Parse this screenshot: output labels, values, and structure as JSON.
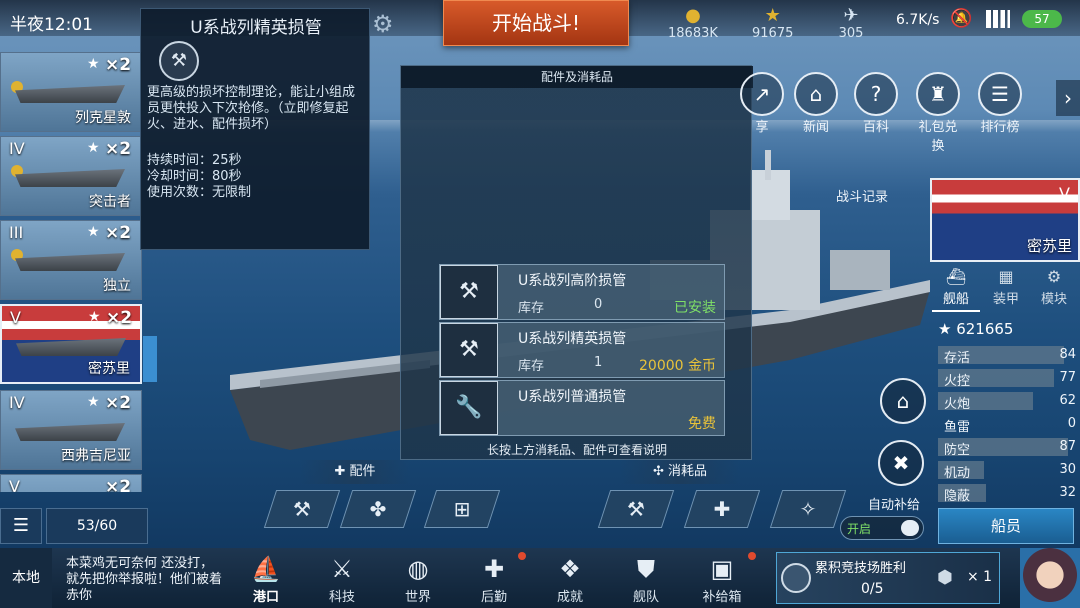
{
  "status": {
    "time": "半夜12:01",
    "network": "6.7K/s",
    "battery": "57"
  },
  "resources": [
    {
      "icon": "coin-icon",
      "value": "18683K"
    },
    {
      "icon": "star-icon",
      "value": "91675"
    },
    {
      "icon": "plane-icon",
      "value": "305"
    }
  ],
  "start_button": "开始战斗!",
  "ship_list": {
    "items": [
      {
        "tier": "",
        "mult": "×2",
        "name": "列克星敦"
      },
      {
        "tier": "IV",
        "mult": "×2",
        "name": "突击者"
      },
      {
        "tier": "III",
        "mult": "×2",
        "name": "独立"
      },
      {
        "tier": "V",
        "mult": "×2",
        "name": "密苏里"
      },
      {
        "tier": "IV",
        "mult": "×2",
        "name": "西弗吉尼亚"
      },
      {
        "tier": "V",
        "mult": "×2",
        "name": ""
      }
    ],
    "count": "53/60"
  },
  "tooltip": {
    "title": "U系战列精英损管",
    "desc": "更高级的损坏控制理论，能让小组成员更快投入下次抢修。（立即修复起火、进水、配件损坏）",
    "duration": "持续时间：25秒",
    "cooldown": "冷却时间：80秒",
    "uses": "使用次数：无限制"
  },
  "panel": {
    "title": "配件及消耗品",
    "stock_label": "库存",
    "items": [
      {
        "name": "U系战列高阶损管",
        "qty": "0",
        "state": "已安装",
        "color": "#7fe067"
      },
      {
        "name": "U系战列精英损管",
        "qty": "1",
        "state": "20000 金币",
        "color": "#e8c23a"
      },
      {
        "name": "U系战列普通损管",
        "qty": "",
        "state": "免费",
        "color": "#e8c23a"
      }
    ],
    "note": "长按上方消耗品、配件可查看说明"
  },
  "top_nav": [
    {
      "label": "享",
      "icon": "share-icon"
    },
    {
      "label": "新闻",
      "icon": "news-icon"
    },
    {
      "label": "百科",
      "icon": "wiki-icon"
    },
    {
      "label": "礼包兑换",
      "icon": "gift-icon"
    },
    {
      "label": "排行榜",
      "icon": "ranking-icon"
    }
  ],
  "battle_log": "战斗记录",
  "right_panel": {
    "tier": "V",
    "ship_name": "密苏里",
    "tabs": [
      "舰船",
      "装甲",
      "模块"
    ],
    "score": "621665",
    "stats": [
      {
        "label": "存活",
        "value": "84"
      },
      {
        "label": "火控",
        "value": "77"
      },
      {
        "label": "火炮",
        "value": "62"
      },
      {
        "label": "鱼雷",
        "value": "0"
      },
      {
        "label": "防空",
        "value": "87"
      },
      {
        "label": "机动",
        "value": "30"
      },
      {
        "label": "隐蔽",
        "value": "32"
      }
    ],
    "crew": "船员"
  },
  "bottom_sections": {
    "parts": "配件",
    "consumables": "消耗品"
  },
  "auto_supply": {
    "label": "自动补给",
    "state": "开启"
  },
  "bottom_bar": {
    "local": "本地",
    "chat": "本菜鸡无可奈何 还没打，就先把你举报啦！他们被着赤你",
    "nav": [
      "港口",
      "科技",
      "世界",
      "后勤",
      "成就",
      "舰队",
      "补给箱"
    ],
    "quest_title": "累积竞技场胜利",
    "quest_progress": "0/5",
    "quest_reward": "× 1"
  }
}
